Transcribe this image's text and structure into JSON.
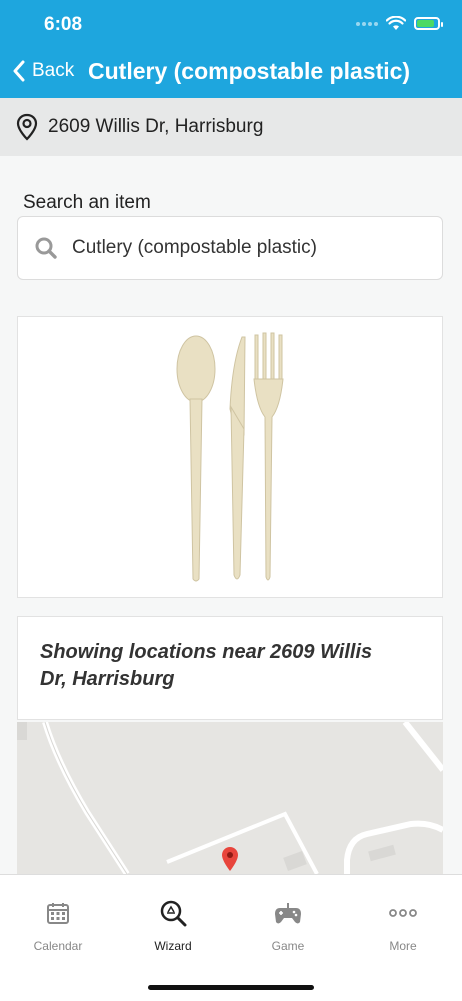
{
  "status": {
    "time": "6:08"
  },
  "header": {
    "back_label": "Back",
    "title": "Cutlery (compostable plastic)",
    "color": "#1ea6de"
  },
  "location": {
    "address": "2609 Willis Dr, Harrisburg"
  },
  "search": {
    "label": "Search an item",
    "value": "Cutlery (compostable plastic)"
  },
  "results": {
    "locations_text": "Showing locations near 2609 Willis Dr, Harrisburg"
  },
  "tabs": [
    {
      "label": "Calendar",
      "icon": "calendar-icon"
    },
    {
      "label": "Wizard",
      "icon": "wizard-search-icon",
      "active": true
    },
    {
      "label": "Game",
      "icon": "gamepad-icon"
    },
    {
      "label": "More",
      "icon": "more-icon"
    }
  ]
}
